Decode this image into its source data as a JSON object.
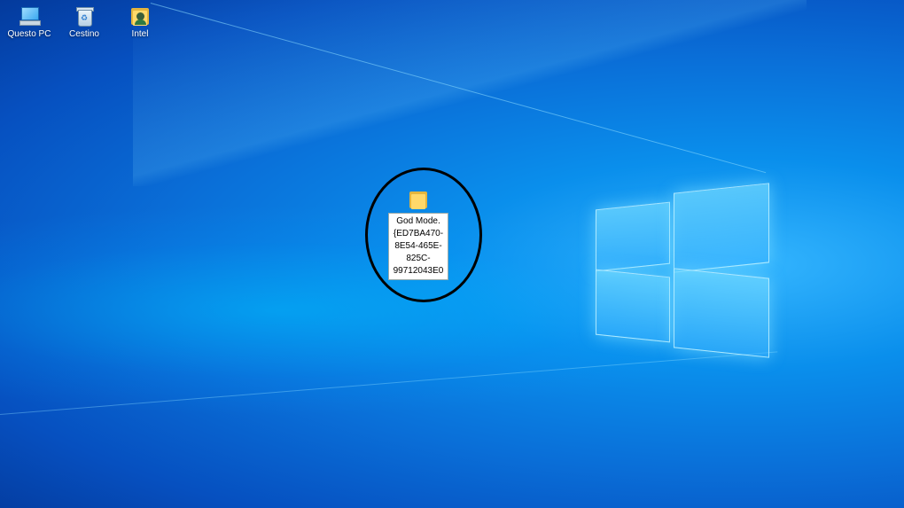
{
  "desktop": {
    "icons": [
      {
        "label": "Questo PC",
        "icon": "pc-icon"
      },
      {
        "label": "Cestino",
        "icon": "recycle-bin-icon"
      },
      {
        "label": "Intel",
        "icon": "folder-user-icon"
      }
    ],
    "renaming_folder": {
      "icon": "folder-icon",
      "name_editing": "God Mode.\n{ED7BA470-\n8E54-465E-\n825C-\n99712043E0"
    }
  },
  "colors": {
    "accent": "#0a6fd8",
    "annotation": "#000000"
  }
}
